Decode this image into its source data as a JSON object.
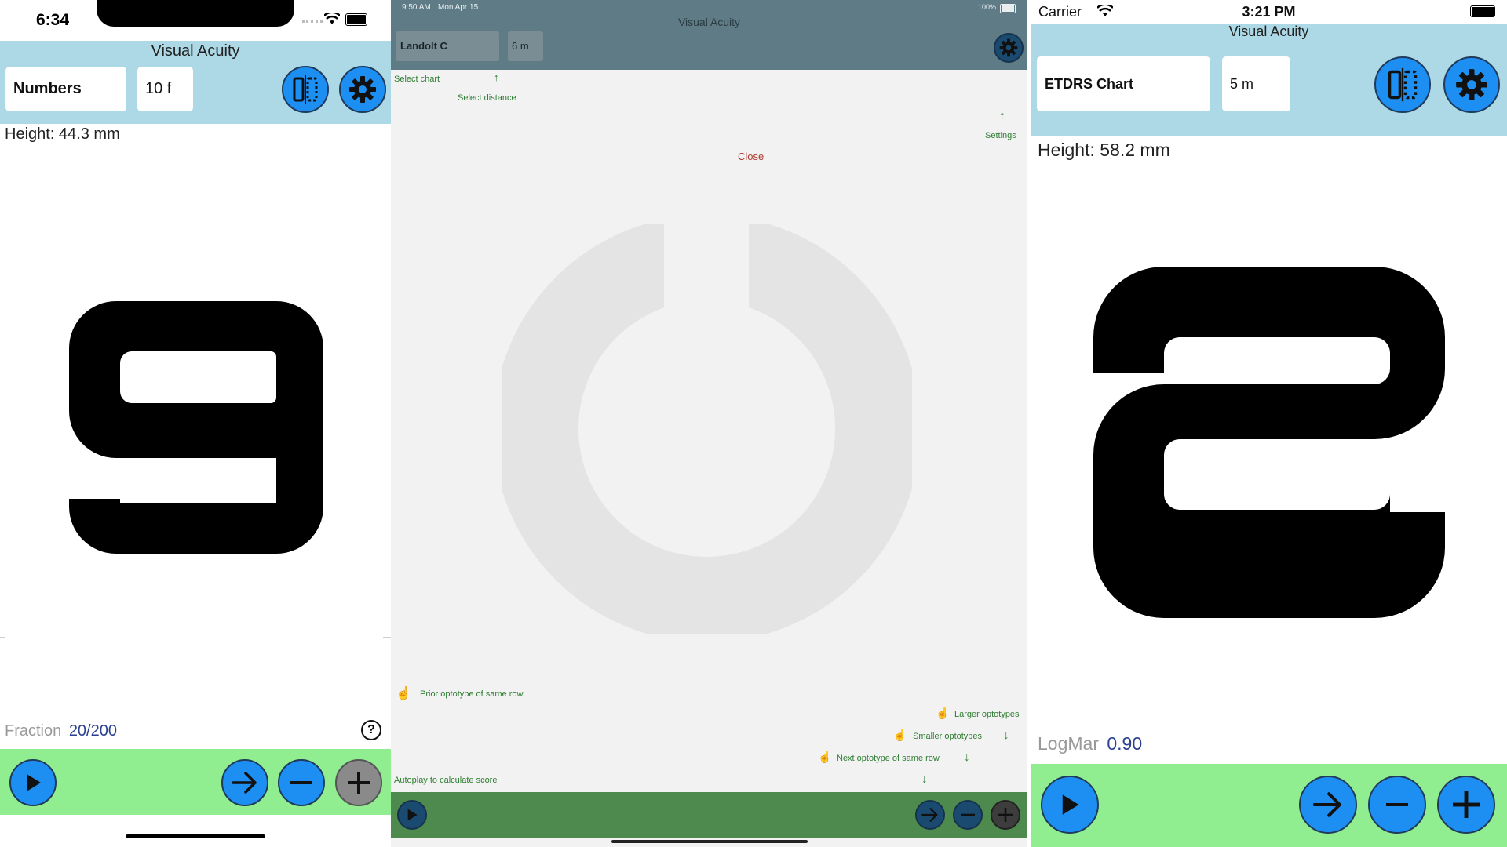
{
  "colors": {
    "accent_blue": "#1e8ff2",
    "header_bg": "#add8e6",
    "bottom_bar": "#90ee90",
    "overlay_header": "#5f7b86",
    "overlay_bar": "#4e8a4e",
    "annotation_green": "#2e7d32",
    "close_red": "#b03a2e"
  },
  "panel_left": {
    "status": {
      "time": "6:34"
    },
    "title": "Visual Acuity",
    "chart_select": "Numbers",
    "distance": "10 f",
    "height_label": "Height: 44.3 mm",
    "optotype": "9",
    "score_label": "Fraction",
    "score_value": "20/200",
    "help_icon": "question-circle-icon",
    "toolbar": {
      "play": "play-icon",
      "next": "arrow-right-icon",
      "minus": "minus-icon",
      "plus": "plus-icon"
    }
  },
  "panel_middle": {
    "status": {
      "time": "9:50 AM",
      "date": "Mon Apr 15",
      "battery": "100%"
    },
    "title": "Visual Acuity",
    "chart_select": "Landolt C",
    "distance": "6 m",
    "close_label": "Close",
    "annotations": {
      "select_chart": "Select chart",
      "select_distance": "Select distance",
      "settings": "Settings",
      "prior": "Prior optotype of same row",
      "larger": "Larger optotypes",
      "smaller": "Smaller optotypes",
      "next_same_row": "Next optotype of same row",
      "autoplay": "Autoplay to calculate score"
    }
  },
  "panel_right": {
    "status": {
      "carrier": "Carrier",
      "time": "3:21 PM"
    },
    "title": "Visual Acuity",
    "chart_select": "ETDRS Chart",
    "distance": "5 m",
    "height_label": "Height: 58.2 mm",
    "optotype": "2",
    "score_label": "LogMar",
    "score_value": "0.90"
  }
}
